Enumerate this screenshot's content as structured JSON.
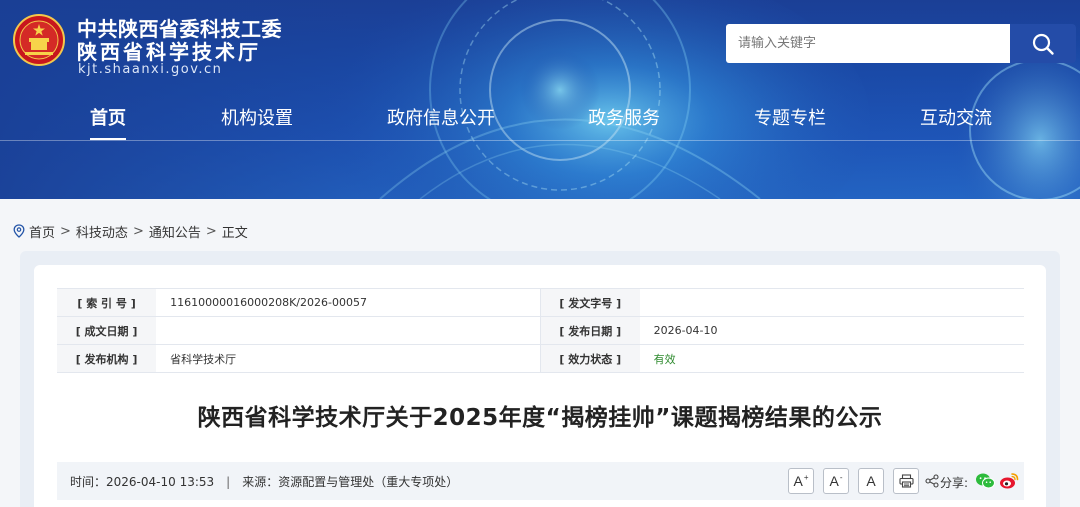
{
  "header": {
    "org_line1": "中共陕西省委科技工委",
    "org_line2": "陕西省科学技术厅",
    "site_url": "kjt.shaanxi.gov.cn"
  },
  "search": {
    "placeholder": "请输入关键字",
    "icon": "search-icon"
  },
  "nav": {
    "items": [
      {
        "label": "首页",
        "active": true
      },
      {
        "label": "机构设置"
      },
      {
        "label": "政府信息公开"
      },
      {
        "label": "政务服务"
      },
      {
        "label": "专题专栏"
      },
      {
        "label": "互动交流"
      }
    ]
  },
  "breadcrumb": {
    "icon": "location-pin-icon",
    "items": [
      "首页",
      "科技动态",
      "通知公告",
      "正文"
    ],
    "separator": ">"
  },
  "meta": {
    "rows": [
      {
        "label1": "[ 索 引 号 ]",
        "value1": "11610000016000208K/2026-00057",
        "label2": "[ 发文字号 ]",
        "value2": ""
      },
      {
        "label1": "[ 成文日期 ]",
        "value1": "",
        "label2": "[ 发布日期 ]",
        "value2": "2026-04-10"
      },
      {
        "label1": "[ 发布机构 ]",
        "value1": "省科学技术厅",
        "label2": "[ 效力状态 ]",
        "value2": "有效"
      }
    ]
  },
  "article": {
    "title": "陕西省科学技术厅关于2025年度“揭榜挂帅”课题揭榜结果的公示"
  },
  "info_bar": {
    "time_label": "时间：",
    "time_value": "2026-04-10 13:53",
    "divider": "|",
    "source_label": "来源：",
    "source_value": "资源配置与管理处（重大专项处）",
    "font_large": "A",
    "font_reset": "A",
    "font_small": "A",
    "share_label": "分享:"
  },
  "colors": {
    "header_blue": "#1e4fae",
    "search_btn": "#244ca8",
    "status_green": "#2d8a2d"
  }
}
